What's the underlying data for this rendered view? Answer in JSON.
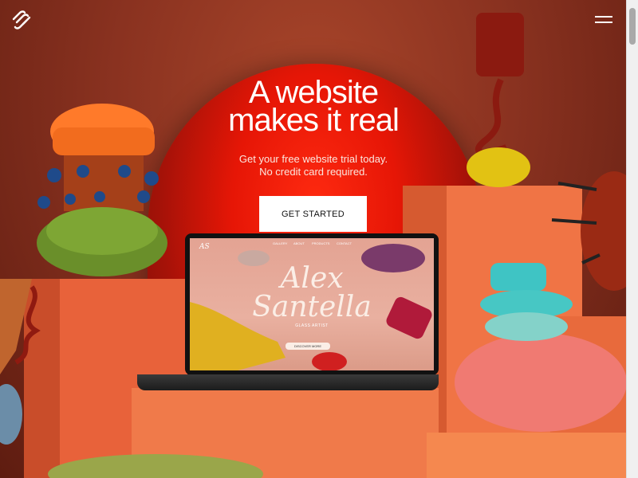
{
  "header": {
    "logo_icon": "squarespace-logo-icon",
    "menu_icon": "hamburger-menu-icon"
  },
  "hero": {
    "title_line1": "A website",
    "title_line2": "makes it real",
    "subtitle_line1": "Get your free website trial today.",
    "subtitle_line2": "No credit card required.",
    "cta_label": "GET STARTED"
  },
  "laptop_site": {
    "logo": "AS",
    "nav": [
      "GALLERY",
      "ABOUT",
      "PRODUCTS",
      "CONTACT"
    ],
    "name_line1": "Alex",
    "name_line2": "Santella",
    "role": "GLASS ARTIST",
    "button": "DISCOVER MORE"
  },
  "colors": {
    "background": "#8a3220",
    "arch": "#e61606",
    "pedestal": "#f06a3a",
    "cta_bg": "#ffffff"
  }
}
